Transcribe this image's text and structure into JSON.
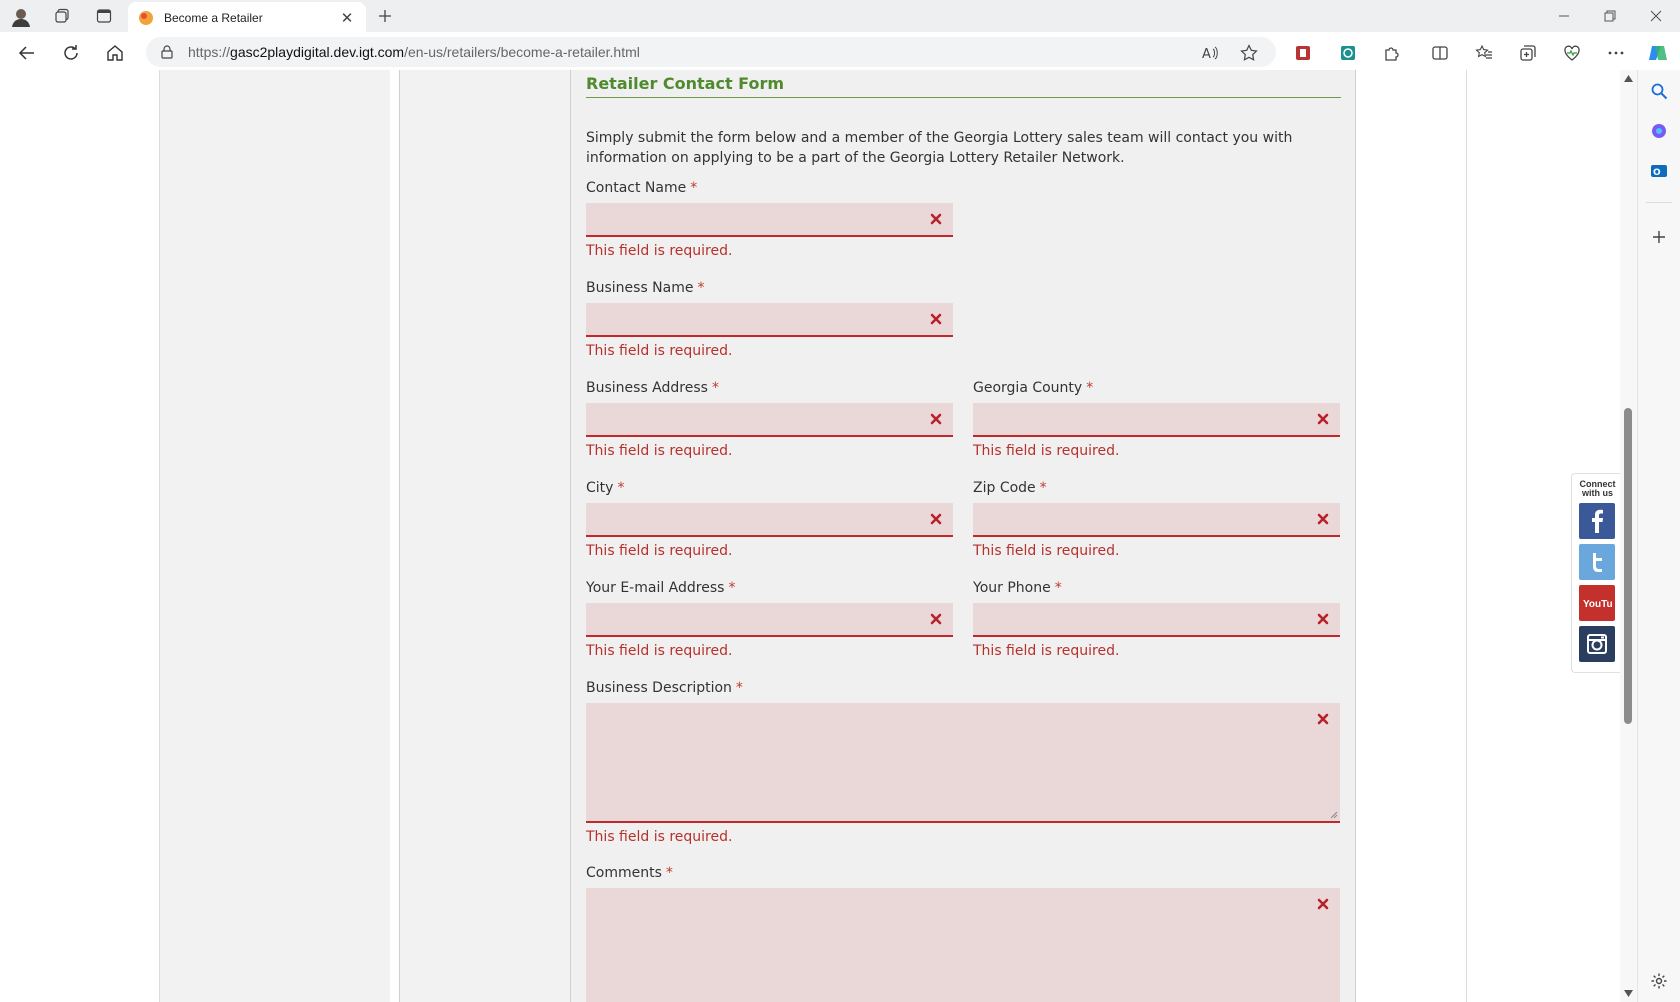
{
  "browser": {
    "tab_title": "Become a Retailer",
    "url_scheme": "https://",
    "url_host": "gasc2playdigital.dev.igt.com",
    "url_path": "/en-us/retailers/become-a-retailer.html"
  },
  "form": {
    "title": "Retailer Contact Form",
    "intro": "Simply submit the form below and a member of the Georgia Lottery sales team will contact you with information on applying to be a part of the Georgia Lottery Retailer Network.",
    "required_mark": "*",
    "error_text": "This field is required.",
    "fields": {
      "contact_name": "Contact Name",
      "business_name": "Business Name",
      "business_address": "Business Address",
      "georgia_county": "Georgia County",
      "city": "City",
      "zip_code": "Zip Code",
      "email": "Your E-mail Address",
      "phone": "Your Phone",
      "business_description": "Business Description",
      "comments": "Comments"
    }
  },
  "social": {
    "caption_line1": "Connect",
    "caption_line2": "with us",
    "youtube_label": "YouTube"
  },
  "colors": {
    "form_title": "#4f8a2e",
    "error": "#b8302b",
    "field_bg": "#ead8d8",
    "facebook": "#3b5998",
    "twitter": "#6aa7dd",
    "youtube": "#c4302b",
    "instagram": "#2c3e60"
  }
}
